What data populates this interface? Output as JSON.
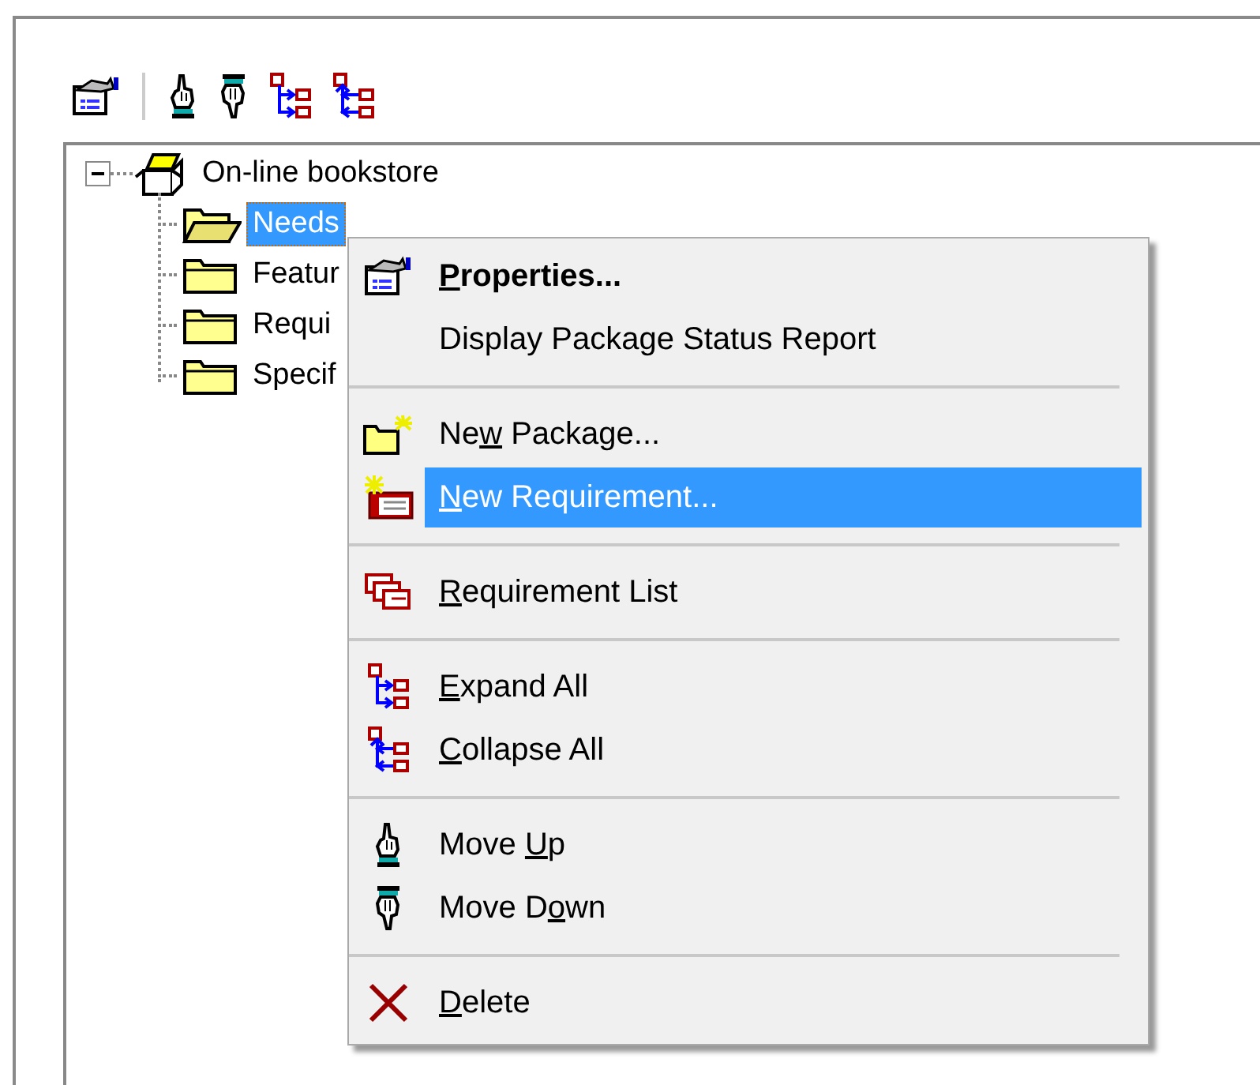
{
  "tree": {
    "root": {
      "label": "On-line bookstore",
      "expanded": true,
      "selected": false,
      "children": [
        {
          "label": "Needs",
          "selected": true
        },
        {
          "label": "Featur",
          "selected": false
        },
        {
          "label": "Requi",
          "selected": false
        },
        {
          "label": "Specif",
          "selected": false
        }
      ]
    }
  },
  "context_menu": {
    "items": [
      {
        "kind": "item",
        "access_key": "P",
        "text_after": "roperties...",
        "bold": true,
        "selected": false
      },
      {
        "kind": "item",
        "text_before": "Display Package Status Report",
        "bold": false,
        "selected": false
      },
      {
        "kind": "separator"
      },
      {
        "kind": "item",
        "text_before": "Ne",
        "access_key": "w",
        "text_after": " Package...",
        "bold": false,
        "selected": false
      },
      {
        "kind": "item",
        "access_key": "N",
        "text_after": "ew Requirement...",
        "bold": false,
        "selected": true
      },
      {
        "kind": "separator"
      },
      {
        "kind": "item",
        "access_key": "R",
        "text_after": "equirement List",
        "bold": false,
        "selected": false
      },
      {
        "kind": "separator"
      },
      {
        "kind": "item",
        "access_key": "E",
        "text_after": "xpand All",
        "bold": false,
        "selected": false
      },
      {
        "kind": "item",
        "access_key": "C",
        "text_after": "ollapse All",
        "bold": false,
        "selected": false
      },
      {
        "kind": "separator"
      },
      {
        "kind": "item",
        "text_before": "Move ",
        "access_key": "U",
        "text_after": "p",
        "bold": false,
        "selected": false
      },
      {
        "kind": "item",
        "text_before": "Move D",
        "access_key": "o",
        "text_after": "wn",
        "bold": false,
        "selected": false
      },
      {
        "kind": "separator"
      },
      {
        "kind": "item",
        "access_key": "D",
        "text_after": "elete",
        "bold": false,
        "selected": false
      }
    ]
  }
}
